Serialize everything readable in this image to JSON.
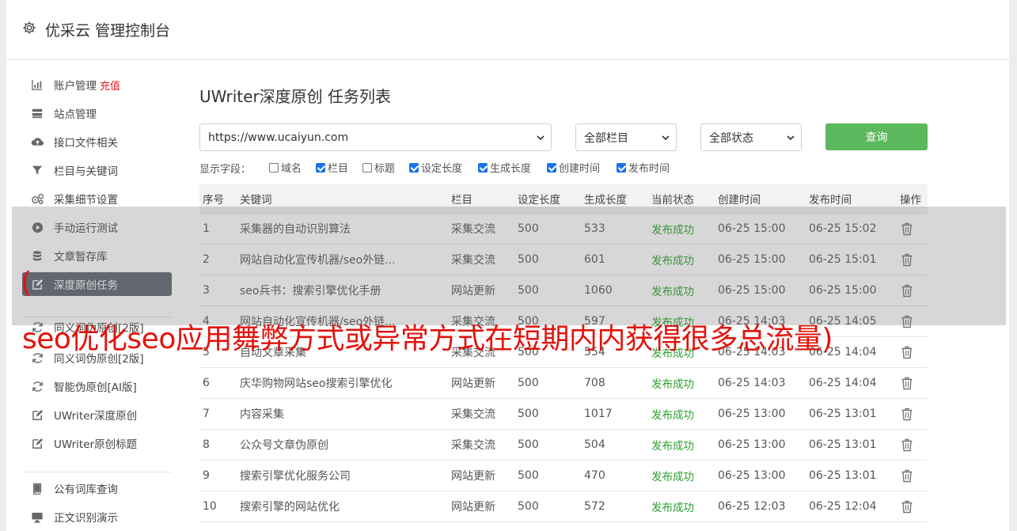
{
  "header": {
    "title": "优采云 管理控制台"
  },
  "sidebar": {
    "items": [
      {
        "label": "账户管理",
        "badge": "充值",
        "icon": "bar-chart-icon"
      },
      {
        "label": "站点管理",
        "icon": "server-icon"
      },
      {
        "label": "接口文件相关",
        "icon": "cloud-upload-icon"
      },
      {
        "label": "栏目与关键词",
        "icon": "filter-icon"
      },
      {
        "label": "采集细节设置",
        "icon": "gears-icon"
      },
      {
        "label": "手动运行测试",
        "icon": "play-icon"
      },
      {
        "label": "文章暂存库",
        "icon": "database-icon"
      },
      {
        "label": "深度原创任务",
        "icon": "edit-icon",
        "active": true
      },
      {
        "label": "同义词伪原创[2版]",
        "icon": "refresh-icon"
      },
      {
        "label": "同义词伪原创[2版]",
        "icon": "refresh-icon"
      },
      {
        "label": "智能伪原创[AI版]",
        "icon": "refresh-icon"
      },
      {
        "label": "UWriter深度原创",
        "icon": "edit-icon"
      },
      {
        "label": "UWriter原创标题",
        "icon": "edit-icon"
      },
      {
        "label": "公有词库查询",
        "icon": "book-icon"
      },
      {
        "label": "正文识别演示",
        "icon": "monitor-icon"
      }
    ]
  },
  "main": {
    "title": "UWriter深度原创 任务列表",
    "site_select": "https://www.ucaiyun.com",
    "column_select": "全部栏目",
    "status_select": "全部状态",
    "query_label": "查询",
    "fields_label": "显示字段：",
    "fields": [
      {
        "label": "域名",
        "checked": false
      },
      {
        "label": "栏目",
        "checked": true
      },
      {
        "label": "标题",
        "checked": false
      },
      {
        "label": "设定长度",
        "checked": true
      },
      {
        "label": "生成长度",
        "checked": true
      },
      {
        "label": "创建时间",
        "checked": true
      },
      {
        "label": "发布时间",
        "checked": true
      }
    ],
    "table": {
      "headers": [
        "序号",
        "关键词",
        "栏目",
        "设定长度",
        "生成长度",
        "当前状态",
        "创建时间",
        "发布时间",
        "操作"
      ],
      "rows": [
        [
          "1",
          "采集器的自动识别算法",
          "采集交流",
          "500",
          "533",
          "发布成功",
          "06-25 15:00",
          "06-25 15:02"
        ],
        [
          "2",
          "网站自动化宣传机器/seo外链...",
          "采集交流",
          "500",
          "601",
          "发布成功",
          "06-25 15:00",
          "06-25 15:01"
        ],
        [
          "3",
          "seo兵书：搜索引擎优化手册",
          "网站更新",
          "500",
          "1060",
          "发布成功",
          "06-25 15:00",
          "06-25 15:00"
        ],
        [
          "4",
          "网站自动化宣传机器/seo外链...",
          "采集交流",
          "500",
          "597",
          "发布成功",
          "06-25 14:03",
          "06-25 14:05"
        ],
        [
          "5",
          "自动文章采集",
          "采集交流",
          "500",
          "554",
          "发布成功",
          "06-25 14:03",
          "06-25 14:04"
        ],
        [
          "6",
          "庆华购物网站seo搜索引擎优化",
          "网站更新",
          "500",
          "708",
          "发布成功",
          "06-25 14:03",
          "06-25 14:04"
        ],
        [
          "7",
          "内容采集",
          "采集交流",
          "500",
          "1017",
          "发布成功",
          "06-25 13:00",
          "06-25 13:01"
        ],
        [
          "8",
          "公众号文章伪原创",
          "采集交流",
          "500",
          "504",
          "发布成功",
          "06-25 13:00",
          "06-25 13:01"
        ],
        [
          "9",
          "搜索引擎优化服务公司",
          "网站更新",
          "500",
          "470",
          "发布成功",
          "06-25 13:00",
          "06-25 13:01"
        ],
        [
          "10",
          "搜索引擎的网站优化",
          "网站更新",
          "500",
          "572",
          "发布成功",
          "06-25 12:03",
          "06-25 12:04"
        ]
      ]
    }
  },
  "overlay": {
    "open_paren": "(",
    "caption": "seo优化seo应用舞弊方式或异常方式在短期内内获得很多总流量)"
  },
  "colors": {
    "accent_green": "#5cb85c",
    "active_nav": "#5e636f",
    "caption_red": "#e3120b",
    "status_green": "#2ca02c"
  }
}
